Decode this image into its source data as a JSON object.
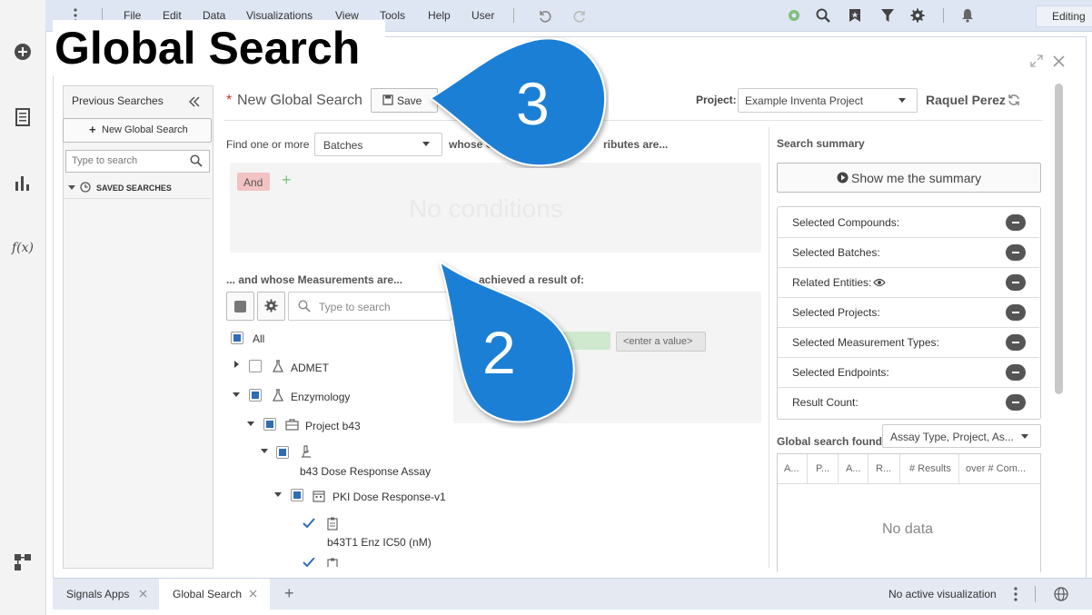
{
  "menubar": {
    "items": [
      "File",
      "Edit",
      "Data",
      "Visualizations",
      "View",
      "Tools",
      "Help",
      "User"
    ],
    "mode": "Editing"
  },
  "overlay_title": "Global Search",
  "callouts": [
    "3",
    "2"
  ],
  "prev_searches": {
    "title": "Previous Searches",
    "new_button": "New Global Search",
    "search_placeholder": "Type to search",
    "saved_label": "SAVED SEARCHES"
  },
  "header": {
    "required_mark": "*",
    "title": "New Global Search",
    "save_label": "Save",
    "project_label": "Project:",
    "project_value": "Example Inventa Project",
    "user_name": "Raquel Perez"
  },
  "find": {
    "prefix": "Find one or more",
    "entity": "Batches",
    "suffix": "whose Co",
    "suffix_tail": "ributes are...",
    "and_label": "And",
    "add_symbol": "+",
    "empty_text": "No conditions"
  },
  "measurements": {
    "label": "... and whose Measurements are...",
    "search_placeholder": "Type to search",
    "result_label_tail": "achieved a result of:",
    "value_placeholder": "<enter a value>",
    "tree": [
      {
        "label": "All"
      },
      {
        "label": "ADMET"
      },
      {
        "label": "Enzymology"
      },
      {
        "label": "Project b43"
      },
      {
        "label": "b43 Dose Response Assay"
      },
      {
        "label": "PKI Dose Response-v1"
      },
      {
        "label": "b43T1 Enz IC50 (nM)"
      }
    ]
  },
  "summary": {
    "label": "Search summary",
    "show_button": "Show me the summary",
    "rows": [
      "Selected Compounds:",
      "Selected Batches:",
      "Related Entities:",
      "Selected Projects:",
      "Selected Measurement Types:",
      "Selected Endpoints:",
      "Result Count:"
    ],
    "found_label": "Global search found",
    "found_select": "Assay Type, Project, As...",
    "columns": [
      "A...",
      "P...",
      "A...",
      "R...",
      "# Results",
      "over # Com..."
    ],
    "empty_text": "No data"
  },
  "bottom": {
    "tabs": [
      "Signals Apps",
      "Global Search"
    ],
    "add_symbol": "+",
    "status": "No active visualization"
  }
}
